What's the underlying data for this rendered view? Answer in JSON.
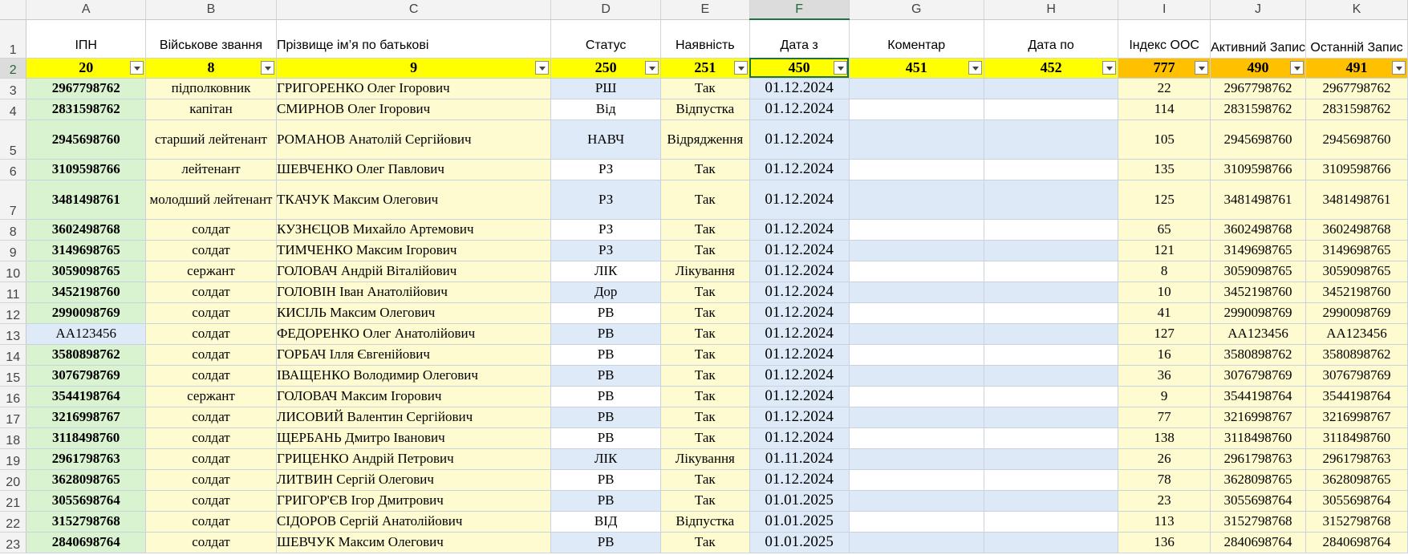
{
  "columns": [
    "A",
    "B",
    "C",
    "D",
    "E",
    "F",
    "G",
    "H",
    "I",
    "J",
    "K"
  ],
  "active_column": "F",
  "header_row": {
    "number": "1",
    "labels": [
      "ІПН",
      "Військове звання",
      "Прізвище ім’я по батькові",
      "Статус",
      "Наявність",
      "Дата з",
      "Коментар",
      "Дата по",
      "Індекс ООС",
      "Активний Запис",
      "Останній Запис"
    ]
  },
  "code_row": {
    "number": "2",
    "codes": [
      "20",
      "8",
      "9",
      "250",
      "251",
      "450",
      "451",
      "452",
      "777",
      "490",
      "491"
    ]
  },
  "colors": {
    "code_row_fill": "#ffff00",
    "code_row_orange": "#ffc000",
    "ipn_fill": "#d9f2d0",
    "rank_fill": "#fefbd0",
    "blue_band": "#deeaf7"
  },
  "filter_icon": "filter-dropdown-icon",
  "rows": [
    {
      "n": "3",
      "ipn": "2967798762",
      "rank": "підполковник",
      "name": "ГРИГОРЕНКО Олег Ігорович",
      "status": "РШ",
      "avail": "Так",
      "date_from": "01.12.2024",
      "comment": "",
      "date_to": "",
      "index": "22",
      "active": "2967798762",
      "last": "2967798762"
    },
    {
      "n": "4",
      "ipn": "2831598762",
      "rank": "капітан",
      "name": "СМИРНОВ Олег Ігорович",
      "status": "Від",
      "avail": "Відпустка",
      "date_from": "01.12.2024",
      "comment": "",
      "date_to": "",
      "index": "114",
      "active": "2831598762",
      "last": "2831598762"
    },
    {
      "n": "5",
      "ipn": "2945698760",
      "rank": "старший лейтенант",
      "name": "РОМАНОВ Анатолій Сергійович",
      "status": "НАВЧ",
      "avail": "Відрядження",
      "date_from": "01.12.2024",
      "comment": "",
      "date_to": "",
      "index": "105",
      "active": "2945698760",
      "last": "2945698760"
    },
    {
      "n": "6",
      "ipn": "3109598766",
      "rank": "лейтенант",
      "name": "ШЕВЧЕНКО Олег Павлович",
      "status": "РЗ",
      "avail": "Так",
      "date_from": "01.12.2024",
      "comment": "",
      "date_to": "",
      "index": "135",
      "active": "3109598766",
      "last": "3109598766"
    },
    {
      "n": "7",
      "ipn": "3481498761",
      "rank": "молодший лейтенант",
      "name": "ТКАЧУК Максим Олегович",
      "status": "РЗ",
      "avail": "Так",
      "date_from": "01.12.2024",
      "comment": "",
      "date_to": "",
      "index": "125",
      "active": "3481498761",
      "last": "3481498761"
    },
    {
      "n": "8",
      "ipn": "3602498768",
      "rank": "солдат",
      "name": "КУЗНЄЦОВ Михайло Артемович",
      "status": "РЗ",
      "avail": "Так",
      "date_from": "01.12.2024",
      "comment": "",
      "date_to": "",
      "index": "65",
      "active": "3602498768",
      "last": "3602498768"
    },
    {
      "n": "9",
      "ipn": "3149698765",
      "rank": "солдат",
      "name": "ТИМЧЕНКО Максим Ігорович",
      "status": "РЗ",
      "avail": "Так",
      "date_from": "01.12.2024",
      "comment": "",
      "date_to": "",
      "index": "121",
      "active": "3149698765",
      "last": "3149698765"
    },
    {
      "n": "10",
      "ipn": "3059098765",
      "rank": "сержант",
      "name": "ГОЛОВАЧ Андрій Віталійович",
      "status": "ЛІК",
      "avail": "Лікування",
      "date_from": "01.12.2024",
      "comment": "",
      "date_to": "",
      "index": "8",
      "active": "3059098765",
      "last": "3059098765"
    },
    {
      "n": "11",
      "ipn": "3452198760",
      "rank": "солдат",
      "name": "ГОЛОВІН Іван Анатолійович",
      "status": "Дор",
      "avail": "Так",
      "date_from": "01.12.2024",
      "comment": "",
      "date_to": "",
      "index": "10",
      "active": "3452198760",
      "last": "3452198760"
    },
    {
      "n": "12",
      "ipn": "2990098769",
      "rank": "солдат",
      "name": "КИСІЛЬ Максим Олегович",
      "status": "РВ",
      "avail": "Так",
      "date_from": "01.12.2024",
      "comment": "",
      "date_to": "",
      "index": "41",
      "active": "2990098769",
      "last": "2990098769"
    },
    {
      "n": "13",
      "ipn": "АА123456",
      "rank": "солдат",
      "name": "ФЕДОРЕНКО Олег Анатолійович",
      "status": "РВ",
      "avail": "Так",
      "date_from": "01.12.2024",
      "comment": "",
      "date_to": "",
      "index": "127",
      "active": "АА123456",
      "last": "АА123456"
    },
    {
      "n": "14",
      "ipn": "3580898762",
      "rank": "солдат",
      "name": "ГОРБАЧ Ілля Євгенійович",
      "status": "РВ",
      "avail": "Так",
      "date_from": "01.12.2024",
      "comment": "",
      "date_to": "",
      "index": "16",
      "active": "3580898762",
      "last": "3580898762"
    },
    {
      "n": "15",
      "ipn": "3076798769",
      "rank": "солдат",
      "name": "ІВАЩЕНКО Володимир Олегович",
      "status": "РВ",
      "avail": "Так",
      "date_from": "01.12.2024",
      "comment": "",
      "date_to": "",
      "index": "36",
      "active": "3076798769",
      "last": "3076798769"
    },
    {
      "n": "16",
      "ipn": "3544198764",
      "rank": "сержант",
      "name": "ГОЛОВАЧ Максим Ігорович",
      "status": "РВ",
      "avail": "Так",
      "date_from": "01.12.2024",
      "comment": "",
      "date_to": "",
      "index": "9",
      "active": "3544198764",
      "last": "3544198764"
    },
    {
      "n": "17",
      "ipn": "3216998767",
      "rank": "солдат",
      "name": "ЛИСОВИЙ Валентин Сергійович",
      "status": "РВ",
      "avail": "Так",
      "date_from": "01.12.2024",
      "comment": "",
      "date_to": "",
      "index": "77",
      "active": "3216998767",
      "last": "3216998767"
    },
    {
      "n": "18",
      "ipn": "3118498760",
      "rank": "солдат",
      "name": "ЩЕРБАНЬ Дмитро Іванович",
      "status": "РВ",
      "avail": "Так",
      "date_from": "01.12.2024",
      "comment": "",
      "date_to": "",
      "index": "138",
      "active": "3118498760",
      "last": "3118498760"
    },
    {
      "n": "19",
      "ipn": "2961798763",
      "rank": "солдат",
      "name": "ГРИЦЕНКО Андрій Петрович",
      "status": "ЛІК",
      "avail": "Лікування",
      "date_from": "01.11.2024",
      "comment": "",
      "date_to": "",
      "index": "26",
      "active": "2961798763",
      "last": "2961798763"
    },
    {
      "n": "20",
      "ipn": "3628098765",
      "rank": "солдат",
      "name": "ЛИТВИН Сергій Олегович",
      "status": "РВ",
      "avail": "Так",
      "date_from": "01.12.2024",
      "comment": "",
      "date_to": "",
      "index": "78",
      "active": "3628098765",
      "last": "3628098765"
    },
    {
      "n": "21",
      "ipn": "3055698764",
      "rank": "солдат",
      "name": "ГРИГОР'ЄВ Ігор Дмитрович",
      "status": "РВ",
      "avail": "Так",
      "date_from": "01.01.2025",
      "comment": "",
      "date_to": "",
      "index": "23",
      "active": "3055698764",
      "last": "3055698764"
    },
    {
      "n": "22",
      "ipn": "3152798768",
      "rank": "солдат",
      "name": "СІДОРОВ Сергій Анатолійович",
      "status": "ВІД",
      "avail": "Відпустка",
      "date_from": "01.01.2025",
      "comment": "",
      "date_to": "",
      "index": "113",
      "active": "3152798768",
      "last": "3152798768"
    },
    {
      "n": "23",
      "ipn": "2840698764",
      "rank": "солдат",
      "name": "ШЕВЧУК Максим Олегович",
      "status": "РВ",
      "avail": "Так",
      "date_from": "01.01.2025",
      "comment": "",
      "date_to": "",
      "index": "136",
      "active": "2840698764",
      "last": "2840698764"
    }
  ]
}
